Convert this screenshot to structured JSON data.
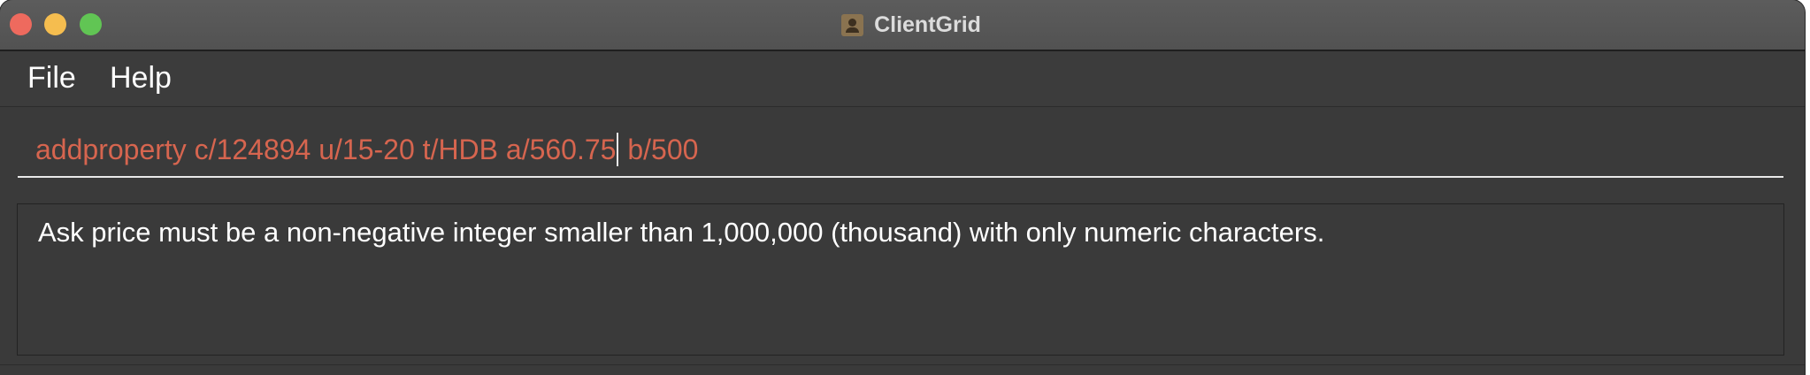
{
  "window": {
    "title": "ClientGrid",
    "app_icon": "contact-card-icon"
  },
  "traffic_lights": {
    "close": "#ee6a5e",
    "minimize": "#f5bd4f",
    "maximize": "#61c554"
  },
  "menu": {
    "items": [
      {
        "label": "File"
      },
      {
        "label": "Help"
      }
    ]
  },
  "command": {
    "value_before_caret": "addproperty c/124894 u/15-20 t/HDB a/560.75",
    "value_after_caret": " b/500",
    "text_color": "#d6654f"
  },
  "result": {
    "message": "Ask price must be a non-negative integer smaller than 1,000,000 (thousand) with only numeric characters."
  }
}
